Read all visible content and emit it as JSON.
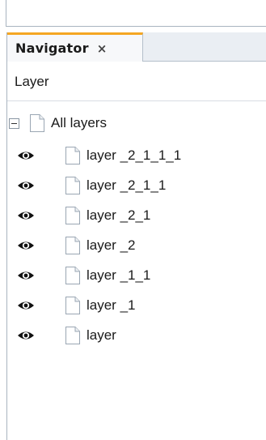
{
  "panel": {
    "tab_title": "Navigator",
    "tab_close": "×",
    "column_header": "Layer"
  },
  "tree": {
    "root_label": "All layers",
    "layers": [
      {
        "label": "layer _2_1_1_1",
        "visible": true
      },
      {
        "label": "layer _2_1_1",
        "visible": true
      },
      {
        "label": "layer _2_1",
        "visible": true
      },
      {
        "label": "layer _2",
        "visible": true
      },
      {
        "label": "layer _1_1",
        "visible": true
      },
      {
        "label": "layer _1",
        "visible": true
      },
      {
        "label": "layer",
        "visible": true
      }
    ]
  },
  "icons": {
    "collapse": "collapse-minus-icon",
    "document": "document-icon",
    "visibility": "eye-icon"
  },
  "colors": {
    "tab_accent": "#f5a623",
    "border": "#a9b4c0"
  }
}
